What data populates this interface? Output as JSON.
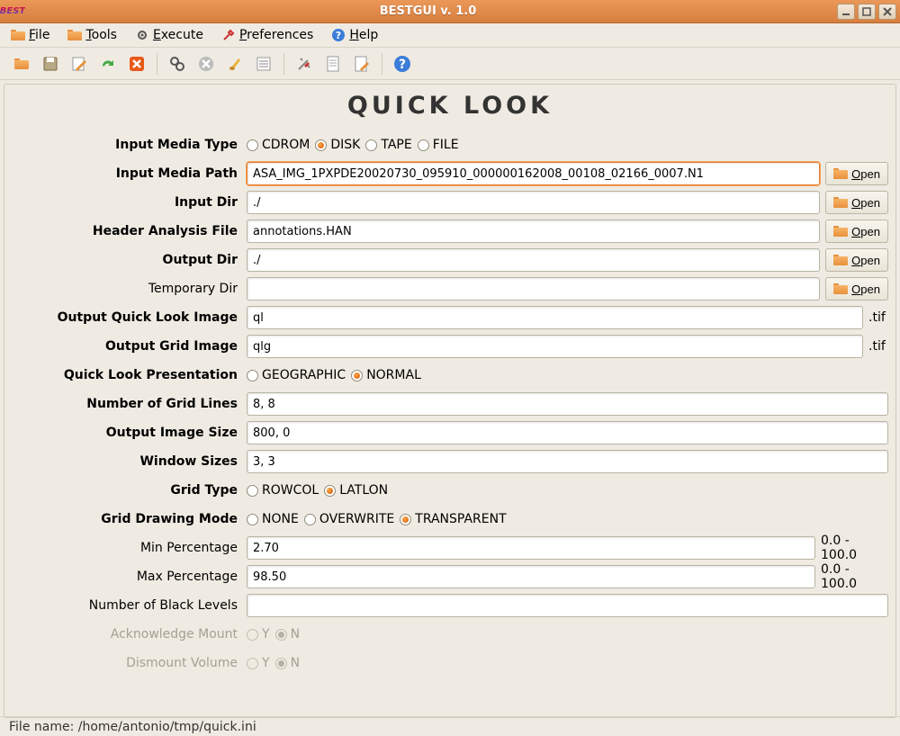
{
  "window": {
    "title": "BESTGUI v. 1.0",
    "logo_text": "BEST"
  },
  "menubar": [
    {
      "icon": "file",
      "label": "File",
      "mnemonic": "F"
    },
    {
      "icon": "tools",
      "label": "Tools",
      "mnemonic": "T"
    },
    {
      "icon": "execute",
      "label": "Execute",
      "mnemonic": "E"
    },
    {
      "icon": "preferences",
      "label": "Preferences",
      "mnemonic": "P"
    },
    {
      "icon": "help",
      "label": "Help",
      "mnemonic": "H"
    }
  ],
  "page": {
    "title": "QUICK LOOK"
  },
  "labels": {
    "input_media_type": "Input Media Type",
    "input_media_path": "Input Media Path",
    "input_dir": "Input Dir",
    "header_analysis_file": "Header Analysis File",
    "output_dir": "Output Dir",
    "temporary_dir": "Temporary Dir",
    "output_ql_image": "Output Quick Look Image",
    "output_grid_image": "Output Grid Image",
    "ql_presentation": "Quick Look Presentation",
    "num_grid_lines": "Number of Grid Lines",
    "output_image_size": "Output Image Size",
    "window_sizes": "Window Sizes",
    "grid_type": "Grid Type",
    "grid_drawing_mode": "Grid Drawing Mode",
    "min_percentage": "Min Percentage",
    "max_percentage": "Max Percentage",
    "num_black_levels": "Number of Black Levels",
    "ack_mount": "Acknowledge Mount",
    "dismount_volume": "Dismount Volume"
  },
  "open_label": "Open",
  "radios": {
    "media_type": {
      "options": [
        "CDROM",
        "DISK",
        "TAPE",
        "FILE"
      ],
      "selected": "DISK"
    },
    "presentation": {
      "options": [
        "GEOGRAPHIC",
        "NORMAL"
      ],
      "selected": "NORMAL"
    },
    "grid_type": {
      "options": [
        "ROWCOL",
        "LATLON"
      ],
      "selected": "LATLON"
    },
    "grid_draw": {
      "options": [
        "NONE",
        "OVERWRITE",
        "TRANSPARENT"
      ],
      "selected": "TRANSPARENT"
    },
    "ack_mount": {
      "options": [
        "Y",
        "N"
      ],
      "selected": "N"
    },
    "dismount": {
      "options": [
        "Y",
        "N"
      ],
      "selected": "N"
    }
  },
  "values": {
    "input_media_path": "ASA_IMG_1PXPDE20020730_095910_000000162008_00108_02166_0007.N1",
    "input_dir": "./",
    "header_file": "annotations.HAN",
    "output_dir": "./",
    "temporary_dir": "",
    "ql_image": "ql",
    "grid_image": "qlg",
    "num_grid_lines": "8, 8",
    "output_image_size": "800, 0",
    "window_sizes": "3, 3",
    "min_percentage": "2.70",
    "max_percentage": "98.50",
    "num_black_levels": ""
  },
  "suffix_tif": ".tif",
  "hint_pct": "0.0 - 100.0",
  "statusbar": "File name: /home/antonio/tmp/quick.ini"
}
